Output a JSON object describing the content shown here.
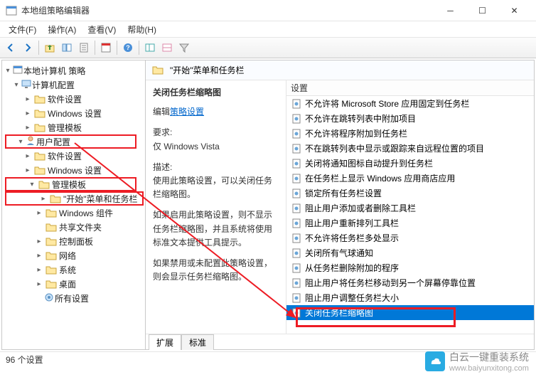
{
  "window": {
    "title": "本地组策略编辑器"
  },
  "menubar": {
    "items": [
      "文件(F)",
      "操作(A)",
      "查看(V)",
      "帮助(H)"
    ]
  },
  "tree": {
    "root": "本地计算机 策略",
    "computer_config": "计算机配置",
    "cc_software": "软件设置",
    "cc_windows": "Windows 设置",
    "cc_admin": "管理模板",
    "user_config": "用户配置",
    "uc_software": "软件设置",
    "uc_windows": "Windows 设置",
    "uc_admin": "管理模板",
    "uc_start": "\"开始\"菜单和任务栏",
    "uc_wincomp": "Windows 组件",
    "uc_shared": "共享文件夹",
    "uc_control": "控制面板",
    "uc_network": "网络",
    "uc_system": "系统",
    "uc_desktop": "桌面",
    "uc_all": "所有设置"
  },
  "header": {
    "title": "\"开始\"菜单和任务栏"
  },
  "desc": {
    "title": "关闭任务栏缩略图",
    "edit_link_prefix": "编辑",
    "edit_link": "策略设置",
    "req_label": "要求:",
    "req_value": "仅 Windows Vista",
    "desc_label": "描述:",
    "desc_text": "使用此策略设置，可以关闭任务栏缩略图。",
    "para2": "如果启用此策略设置，则不显示任务栏缩略图，并且系统将使用标准文本提供工具提示。",
    "para3": "如果禁用或未配置此策略设置，则会显示任务栏缩略图。"
  },
  "list": {
    "header": "设置",
    "items": [
      "不允许将 Microsoft Store 应用固定到任务栏",
      "不允许在跳转列表中附加项目",
      "不允许将程序附加到任务栏",
      "不在跳转列表中显示或跟踪来自远程位置的项目",
      "关闭将通知图标自动提升到任务栏",
      "在任务栏上显示 Windows 应用商店应用",
      "锁定所有任务栏设置",
      "阻止用户添加或者删除工具栏",
      "阻止用户重新排列工具栏",
      "不允许将任务栏多处显示",
      "关闭所有气球通知",
      "从任务栏删除附加的程序",
      "阻止用户将任务栏移动到另一个屏幕停靠位置",
      "阻止用户调整任务栏大小",
      "关闭任务栏缩略图"
    ],
    "selected_index": 14
  },
  "tabs": {
    "extended": "扩展",
    "standard": "标准"
  },
  "statusbar": {
    "text": "96 个设置"
  },
  "watermark": {
    "text": "白云一键重装系统",
    "url": "www.baiyunxitong.com"
  }
}
